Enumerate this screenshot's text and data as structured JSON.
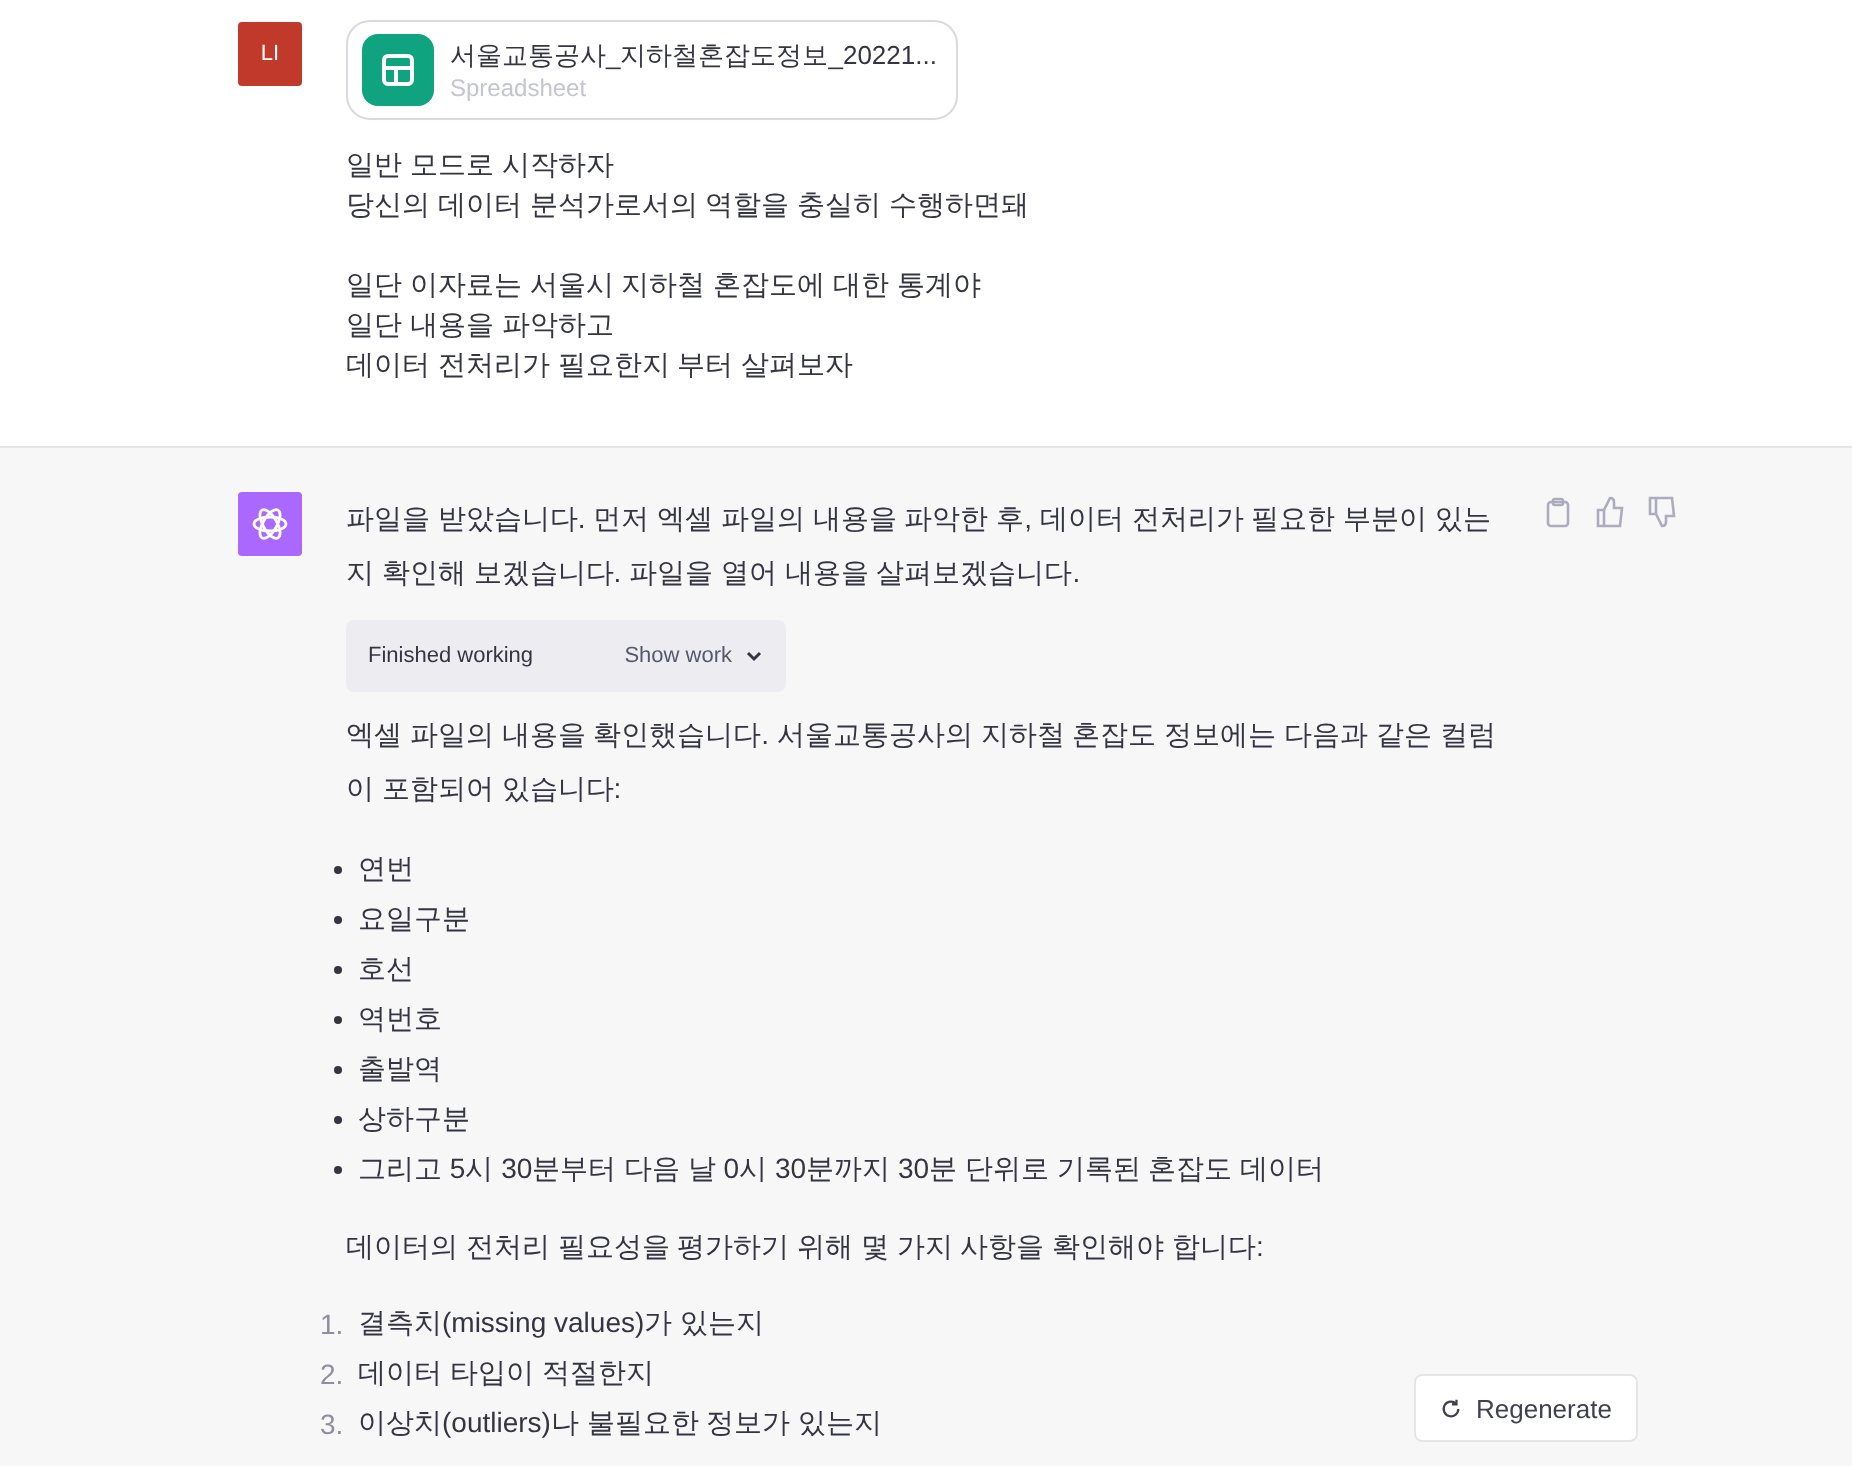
{
  "user_message": {
    "avatar": "LI",
    "attachment": {
      "filename": "서울교통공사_지하철혼잡도정보_20221...",
      "type": "Spreadsheet"
    },
    "paragraphs": [
      [
        "일반 모드로 시작하자",
        "당신의 데이터 분석가로서의 역할을 충실히 수행하면돼"
      ],
      [
        "일단 이자료는 서울시 지하철 혼잡도에 대한 통계야",
        "일단 내용을 파악하고",
        "데이터 전처리가 필요한지 부터 살펴보자"
      ]
    ]
  },
  "assistant_message": {
    "intro": "파일을 받았습니다. 먼저 엑셀 파일의 내용을 파악한 후, 데이터 전처리가 필요한 부분이 있는지 확인해 보겠습니다. 파일을 열어 내용을 살펴보겠습니다.",
    "work_panel": {
      "status": "Finished working",
      "toggle": "Show work",
      "expanded": false
    },
    "summary": "엑셀 파일의 내용을 확인했습니다. 서울교통공사의 지하철 혼잡도 정보에는 다음과 같은 컬럼이 포함되어 있습니다:",
    "columns": [
      "연번",
      "요일구분",
      "호선",
      "역번호",
      "출발역",
      "상하구분",
      "그리고 5시 30분부터 다음 날 0시 30분까지 30분 단위로 기록된 혼잡도 데이터"
    ],
    "checks_intro": "데이터의 전처리 필요성을 평가하기 위해 몇 가지 사항을 확인해야 합니다:",
    "checks": [
      {
        "number": "1.",
        "text": "결측치(missing values)가 있는지"
      },
      {
        "number": "2.",
        "text": "데이터 타입이 적절한지"
      },
      {
        "number": "3.",
        "text": "이상치(outliers)나 불필요한 정보가 있는지"
      }
    ]
  },
  "regenerate_button": "Regenerate"
}
